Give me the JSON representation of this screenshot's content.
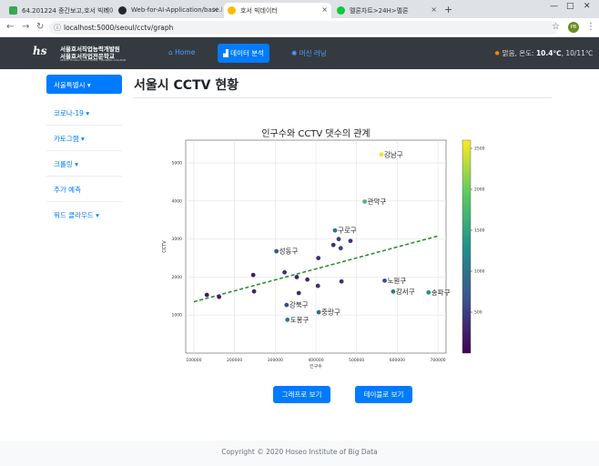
{
  "browser": {
    "tabs": [
      {
        "title": "64.201224 중간보고,호서 빅데이",
        "color": "#34a853",
        "active": false
      },
      {
        "title": "Web-for-AI-Application/base.ht",
        "color": "#24292e",
        "active": false
      },
      {
        "title": "호서 빅데이터",
        "color": "#fbbc04",
        "active": true
      },
      {
        "title": "멜론차트>24H>멜론",
        "color": "#00cd3c",
        "active": false
      }
    ],
    "url": "localhost:5000/seoul/cctv/graph",
    "profile": "PB"
  },
  "navbar": {
    "logo_line1": "서울호서직업능력개발원",
    "logo_line2": "서울호서직업전문학교",
    "logo_line3": "SEOUL HOSEO VOCATIONAL TRAINING COLLEGE",
    "items": [
      {
        "label": "Home",
        "icon": "home-icon",
        "active": false
      },
      {
        "label": "데이터 분석",
        "icon": "chart-icon",
        "active": true
      },
      {
        "label": "머신 러닝",
        "icon": "brain-icon",
        "active": false
      }
    ],
    "weather_text": "맑음, 온도: ",
    "weather_temp": "10.4℃",
    "weather_range": ", 10/11℃"
  },
  "sidebar": {
    "items": [
      {
        "label": "서울특별시 ▾",
        "active": true
      },
      {
        "label": "코로나-19 ▾",
        "active": false
      },
      {
        "label": "카토그램 ▾",
        "active": false
      },
      {
        "label": "크롤링 ▾",
        "active": false
      },
      {
        "label": "주가 예측",
        "active": false
      },
      {
        "label": "워드 클라우드 ▾",
        "active": false
      }
    ]
  },
  "page": {
    "title": "서울시 CCTV 현황"
  },
  "buttons": {
    "graph": "그래프로 보기",
    "table": "테이블로 보기"
  },
  "footer": "Copyright © 2020 Hoseo Institute of Big Data",
  "chart_data": {
    "type": "scatter",
    "title": "인구수와 CCTV 댓수의 관계",
    "xlabel": "인구수",
    "ylabel": "CCTV",
    "xlim": [
      80000,
      720000
    ],
    "ylim": [
      0,
      5600
    ],
    "xticks": [
      100000,
      200000,
      300000,
      400000,
      500000,
      600000,
      700000
    ],
    "yticks": [
      1000,
      2000,
      3000,
      4000,
      5000
    ],
    "colorbar": {
      "min": 0,
      "max": 2600,
      "ticks": [
        500,
        1000,
        1500,
        2000,
        2500
      ]
    },
    "trend": {
      "x": [
        100000,
        700000
      ],
      "y": [
        1350,
        3080
      ],
      "color": "#228b22"
    },
    "points": [
      {
        "x": 561000,
        "y": 5221,
        "label": "강남구",
        "c": 2540
      },
      {
        "x": 520000,
        "y": 3985,
        "label": "관악구",
        "c": 1760
      },
      {
        "x": 447000,
        "y": 3227,
        "label": "구로구",
        "c": 1020
      },
      {
        "x": 303000,
        "y": 2679,
        "label": "성동구",
        "c": 700
      },
      {
        "x": 569000,
        "y": 1906,
        "label": "노원구",
        "c": 650
      },
      {
        "x": 590000,
        "y": 1620,
        "label": "강서구",
        "c": 1050
      },
      {
        "x": 677000,
        "y": 1596,
        "label": "송파구",
        "c": 1300
      },
      {
        "x": 328000,
        "y": 1266,
        "label": "강북구",
        "c": 560
      },
      {
        "x": 407000,
        "y": 1076,
        "label": "중랑구",
        "c": 950
      },
      {
        "x": 330000,
        "y": 878,
        "label": "도봉구",
        "c": 1080
      },
      {
        "x": 456000,
        "y": 3000,
        "label": "",
        "c": 500
      },
      {
        "x": 485000,
        "y": 2950,
        "label": "",
        "c": 400
      },
      {
        "x": 443000,
        "y": 2845,
        "label": "",
        "c": 380
      },
      {
        "x": 461000,
        "y": 2760,
        "label": "",
        "c": 500
      },
      {
        "x": 406000,
        "y": 2500,
        "label": "",
        "c": 350
      },
      {
        "x": 246000,
        "y": 2055,
        "label": "",
        "c": 250
      },
      {
        "x": 323000,
        "y": 2126,
        "label": "",
        "c": 380
      },
      {
        "x": 353000,
        "y": 2000,
        "label": "",
        "c": 300
      },
      {
        "x": 379000,
        "y": 1935,
        "label": "",
        "c": 320
      },
      {
        "x": 463000,
        "y": 1885,
        "label": "",
        "c": 380
      },
      {
        "x": 405000,
        "y": 1770,
        "label": "",
        "c": 360
      },
      {
        "x": 248000,
        "y": 1623,
        "label": "",
        "c": 300
      },
      {
        "x": 358000,
        "y": 1580,
        "label": "",
        "c": 330
      },
      {
        "x": 132000,
        "y": 1530,
        "label": "",
        "c": 200
      },
      {
        "x": 162000,
        "y": 1480,
        "label": "",
        "c": 220
      }
    ]
  }
}
